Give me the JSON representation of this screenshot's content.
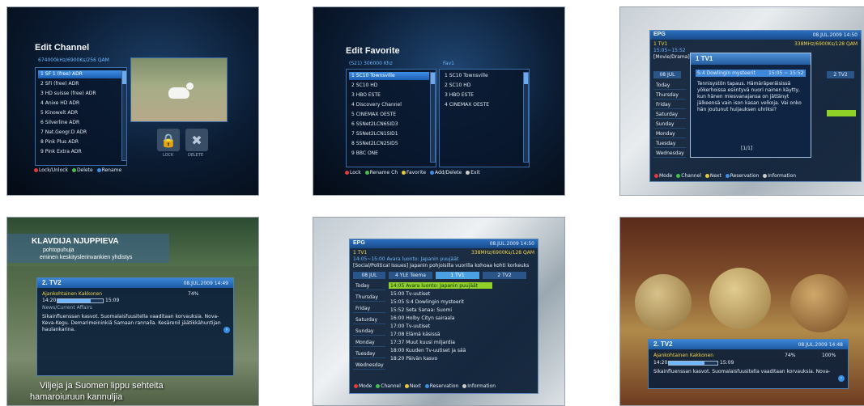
{
  "s1": {
    "title": "Edit Channel",
    "satellite": "674000kHz/6900Ks/256 QAM",
    "channels": [
      "1 SF 1 (free) ADR",
      "2 SFi (free) ADR",
      "3 HD suisse (free) ADR",
      "4 Anixe HD ADR",
      "5 Kinowelt ADR",
      "6 Silverline ADR",
      "7 Nat.Geogr.D ADR",
      "8 Pink Plus ADR",
      "9 Pink Extra ADR"
    ],
    "lock_label": "LOCK",
    "delete_label": "DELETE",
    "legend": [
      "Lock/Unlock",
      "Delete",
      "Rename"
    ]
  },
  "s2": {
    "title": "Edit Favorite",
    "left_header": "(S21) 306000 Khz",
    "right_header": "Fav1",
    "left_list": [
      "1 SC10 Townsville",
      "2 SC10 HD",
      "3 HBO ESTE",
      "4 Discovery Channel",
      "5 CINEMAX OESTE",
      "6 SSNet2LCN6SID3",
      "7 SSNet2LCN1SID1",
      "8 SSNet2LCN2SID5",
      "9 BBC ONE"
    ],
    "right_list": [
      "1 SC10 Townsville",
      "2 SC10 HD",
      "3 HBO ESTE",
      "4 CINEMAX OESTE"
    ],
    "legend": [
      "Lock",
      "Rename Ch",
      "Favorite",
      "Add/Delete",
      "Exit"
    ]
  },
  "s3": {
    "title": "EPG",
    "date": "08.JUL.2009 14:50",
    "channel": "1 TV1",
    "freq": "338MHz/6900Ks/128 QAM",
    "time": "15:05~15:52",
    "genre": "[Movie/Drama]",
    "popup_title": "1 TV1",
    "program": "S:4 Dowlingin mysteerit",
    "program_time": "15:05 ~ 15:52",
    "desc": "Tennisystön tapaus. Hämäräperäisissä yökerhoissa esiintyvä nuori nainen käytty, kun hänen miesvanajansa on jättänyt jälkeensä vain ison kasan velkoja. Vai onko hän joutunut huijauksen uhriksi?",
    "page": "[1/1]",
    "days": [
      "Today",
      "Thursday",
      "Friday",
      "Saturday",
      "Sunday",
      "Monday",
      "Tuesday",
      "Wednesday"
    ],
    "tab_left": "08 JUL",
    "tab_right": "2 TV2",
    "legend": [
      "Mode",
      "Channel",
      "Next",
      "Reservation",
      "Information"
    ]
  },
  "s4": {
    "overlay_name": "KLAVDIJA NJUPPIEVA",
    "overlay_role": "pohtopuhuja",
    "overlay_sub": "eminen keskityslerinvankien yhdistys",
    "channel": "2. TV2",
    "date": "08.JUL.2009 14:49",
    "program": "Ajankohtainen Kakkonen",
    "start": "14:20",
    "end": "15:09",
    "progress": 0.74,
    "signal": "74%",
    "category": "News/Current Affairs",
    "desc": "Sikainfluenssan kasvot. Suomalaisfuusitella vaaditaan korvauksia. Nova-Keva-Kegu. Demarimeininkiä Samaan rannalla. Kesärenil jäätikkähuntijan haulankarina.",
    "subtitle": "Viljeja ja Suomen lippu sehteita",
    "subtitle2": "hamaroiuruun kannuljia"
  },
  "s5": {
    "title": "EPG",
    "date": "08.JUL.2009 14:50",
    "channel": "1 TV1",
    "freq": "338MHz/6900Ks/128 QAM",
    "time": "14:05~15:00 Avara luonto: Japanin puujäät",
    "genre": "[Social/Political Issues] Japanin pohjoisilla vuorilla kohoaa kohti korkeuks",
    "tabs": [
      "08 JUL",
      "4 YLE Teema",
      "1 TV1",
      "2 TV2"
    ],
    "days": [
      "Today",
      "Thursday",
      "Friday",
      "Saturday",
      "Sunday",
      "Monday",
      "Tuesday",
      "Wednesday"
    ],
    "programs": [
      "14:05 Avara luonto: Japanin puujäät",
      "15:00 Tv-uutiset",
      "15:05 S:4 Dowlingin mysteerit",
      "15:52 Seta Sanaa: Suomi",
      "16:00 Holby Cityn sairaala",
      "17:00 Tv-uutiset",
      "17:08 Elämä käsissä",
      "17:37 Muut kuusi miljardia",
      "18:00 Kuuden Tv-uutiset ja sää",
      "18:20 Päivän kasvo"
    ],
    "legend": [
      "Mode",
      "Channel",
      "Next",
      "Reservation",
      "Information"
    ]
  },
  "s6": {
    "channel": "2. TV2",
    "date": "08.JUL.2009 14:48",
    "program": "Ajankohtainen Kakkonen",
    "start": "14:20",
    "end": "15:09",
    "progress": 0.74,
    "signal": "74%",
    "quality": "100%",
    "desc": "Sikainfluenssan kasvot. Suomalaisfuusitella vaaditaan korvauksia. Nova-"
  }
}
